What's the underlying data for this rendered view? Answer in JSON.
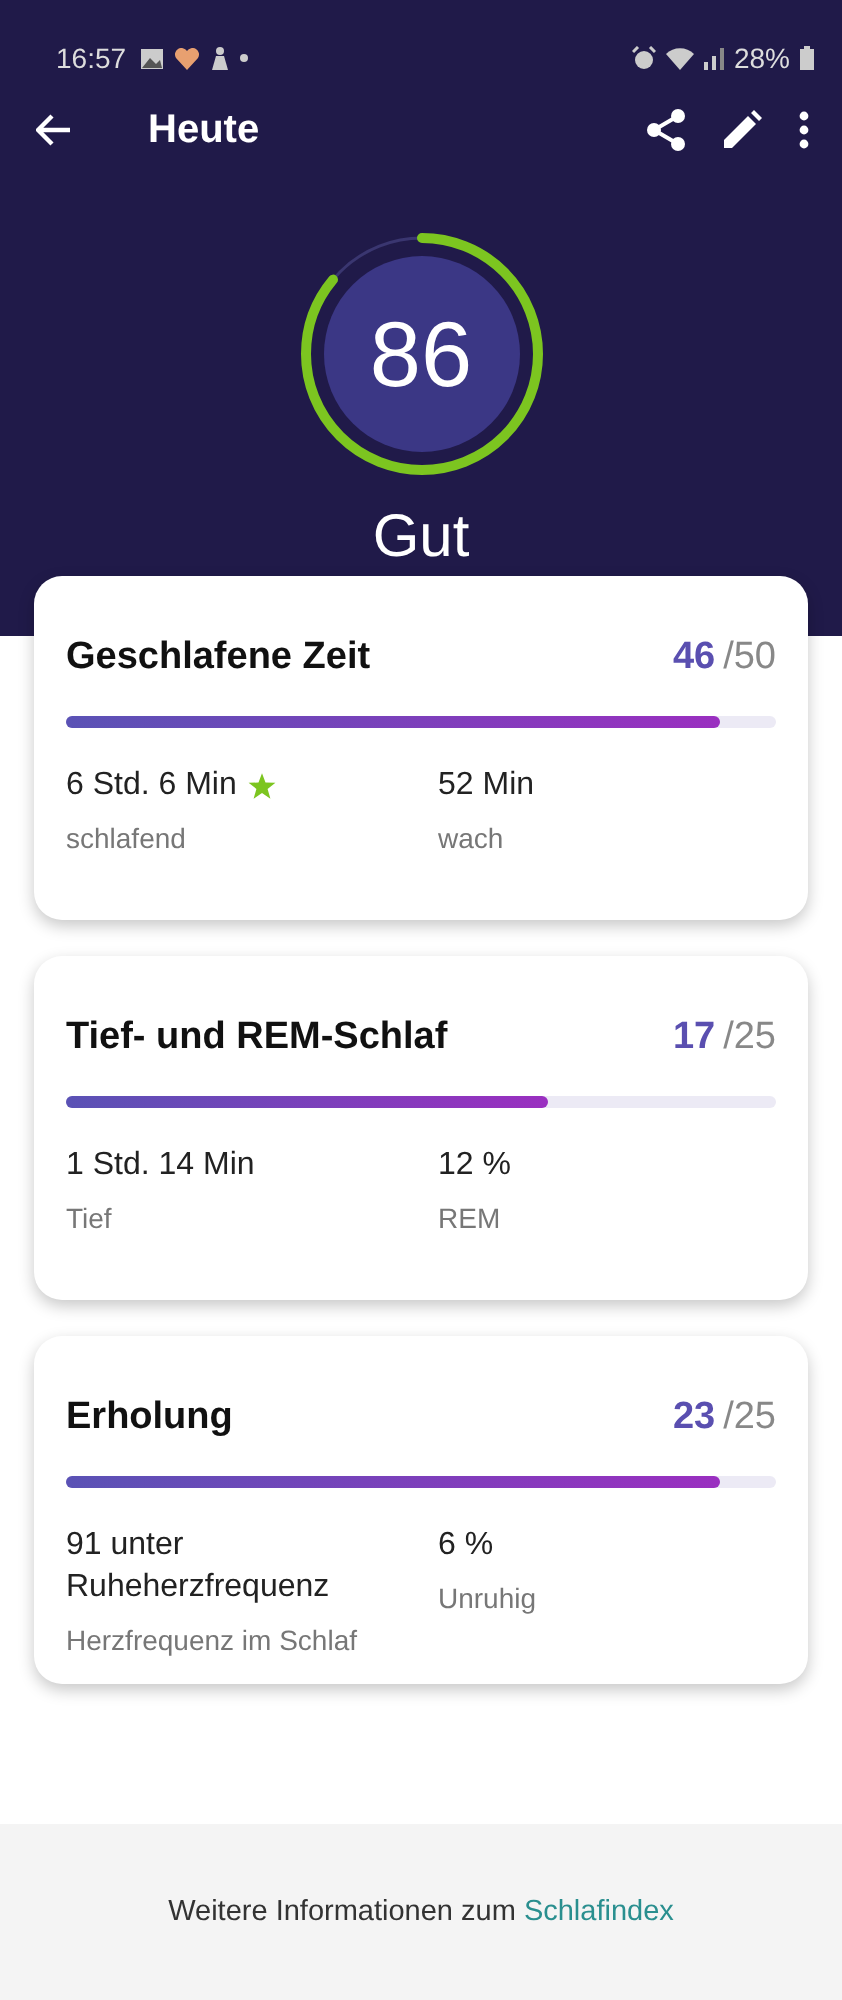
{
  "status_bar": {
    "time": "16:57",
    "battery": "28%"
  },
  "header": {
    "title": "Heute"
  },
  "score": {
    "value": "86",
    "rating": "Gut"
  },
  "cards": [
    {
      "title": "Geschlafene Zeit",
      "score": "46",
      "max": "/50",
      "level": 0.92,
      "stats": [
        {
          "value": "6 Std. 6 Min",
          "star": true,
          "label": "schlafend"
        },
        {
          "value": "52 Min",
          "star": false,
          "label": "wach"
        }
      ]
    },
    {
      "title": "Tief- und REM-Schlaf",
      "score": "17",
      "max": "/25",
      "level": 0.68,
      "stats": [
        {
          "value": "1 Std. 14 Min",
          "star": false,
          "label": "Tief"
        },
        {
          "value": "12 %",
          "star": false,
          "label": "REM"
        }
      ]
    },
    {
      "title": "Erholung",
      "score": "23",
      "max": "/25",
      "level": 0.92,
      "stats": [
        {
          "value": "91 unter Ruheherzfrequenz",
          "star": false,
          "label": "Herzfrequenz im Schlaf"
        },
        {
          "value": "6 %",
          "star": false,
          "label": "Unruhig"
        }
      ]
    }
  ],
  "footer": {
    "text": "Weitere Informationen zum",
    "link": "Schlafindex"
  }
}
